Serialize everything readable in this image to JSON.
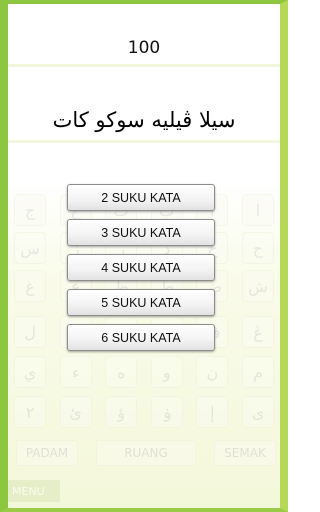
{
  "score": "100",
  "jawi_title": "سيلا ڤيليه سوكو كات",
  "options": [
    "2 SUKU KATA",
    "3 SUKU KATA",
    "4 SUKU KATA",
    "5 SUKU KATA",
    "6 SUKU KATA"
  ],
  "keyboard": {
    "rows": [
      [
        "ج",
        "ح",
        "ت",
        "ب",
        "ا",
        "ا"
      ],
      [
        "س",
        "ز",
        "ر",
        "د",
        "خ",
        "ح"
      ],
      [
        "غ",
        "ع",
        "ظ",
        "ط",
        "ض",
        "ش"
      ],
      [
        "ل",
        "ك",
        "ق",
        "ڤ",
        "ف",
        "ڠ"
      ],
      [
        "ي",
        "ء",
        "ه",
        "و",
        "ن",
        "م"
      ],
      [
        "٢",
        "ئ",
        "ؤ",
        "ۏ",
        "إ",
        "ى"
      ]
    ],
    "delete_label": "PADAM",
    "space_label": "RUANG",
    "check_label": "SEMAK",
    "menu_label": "MENU"
  }
}
